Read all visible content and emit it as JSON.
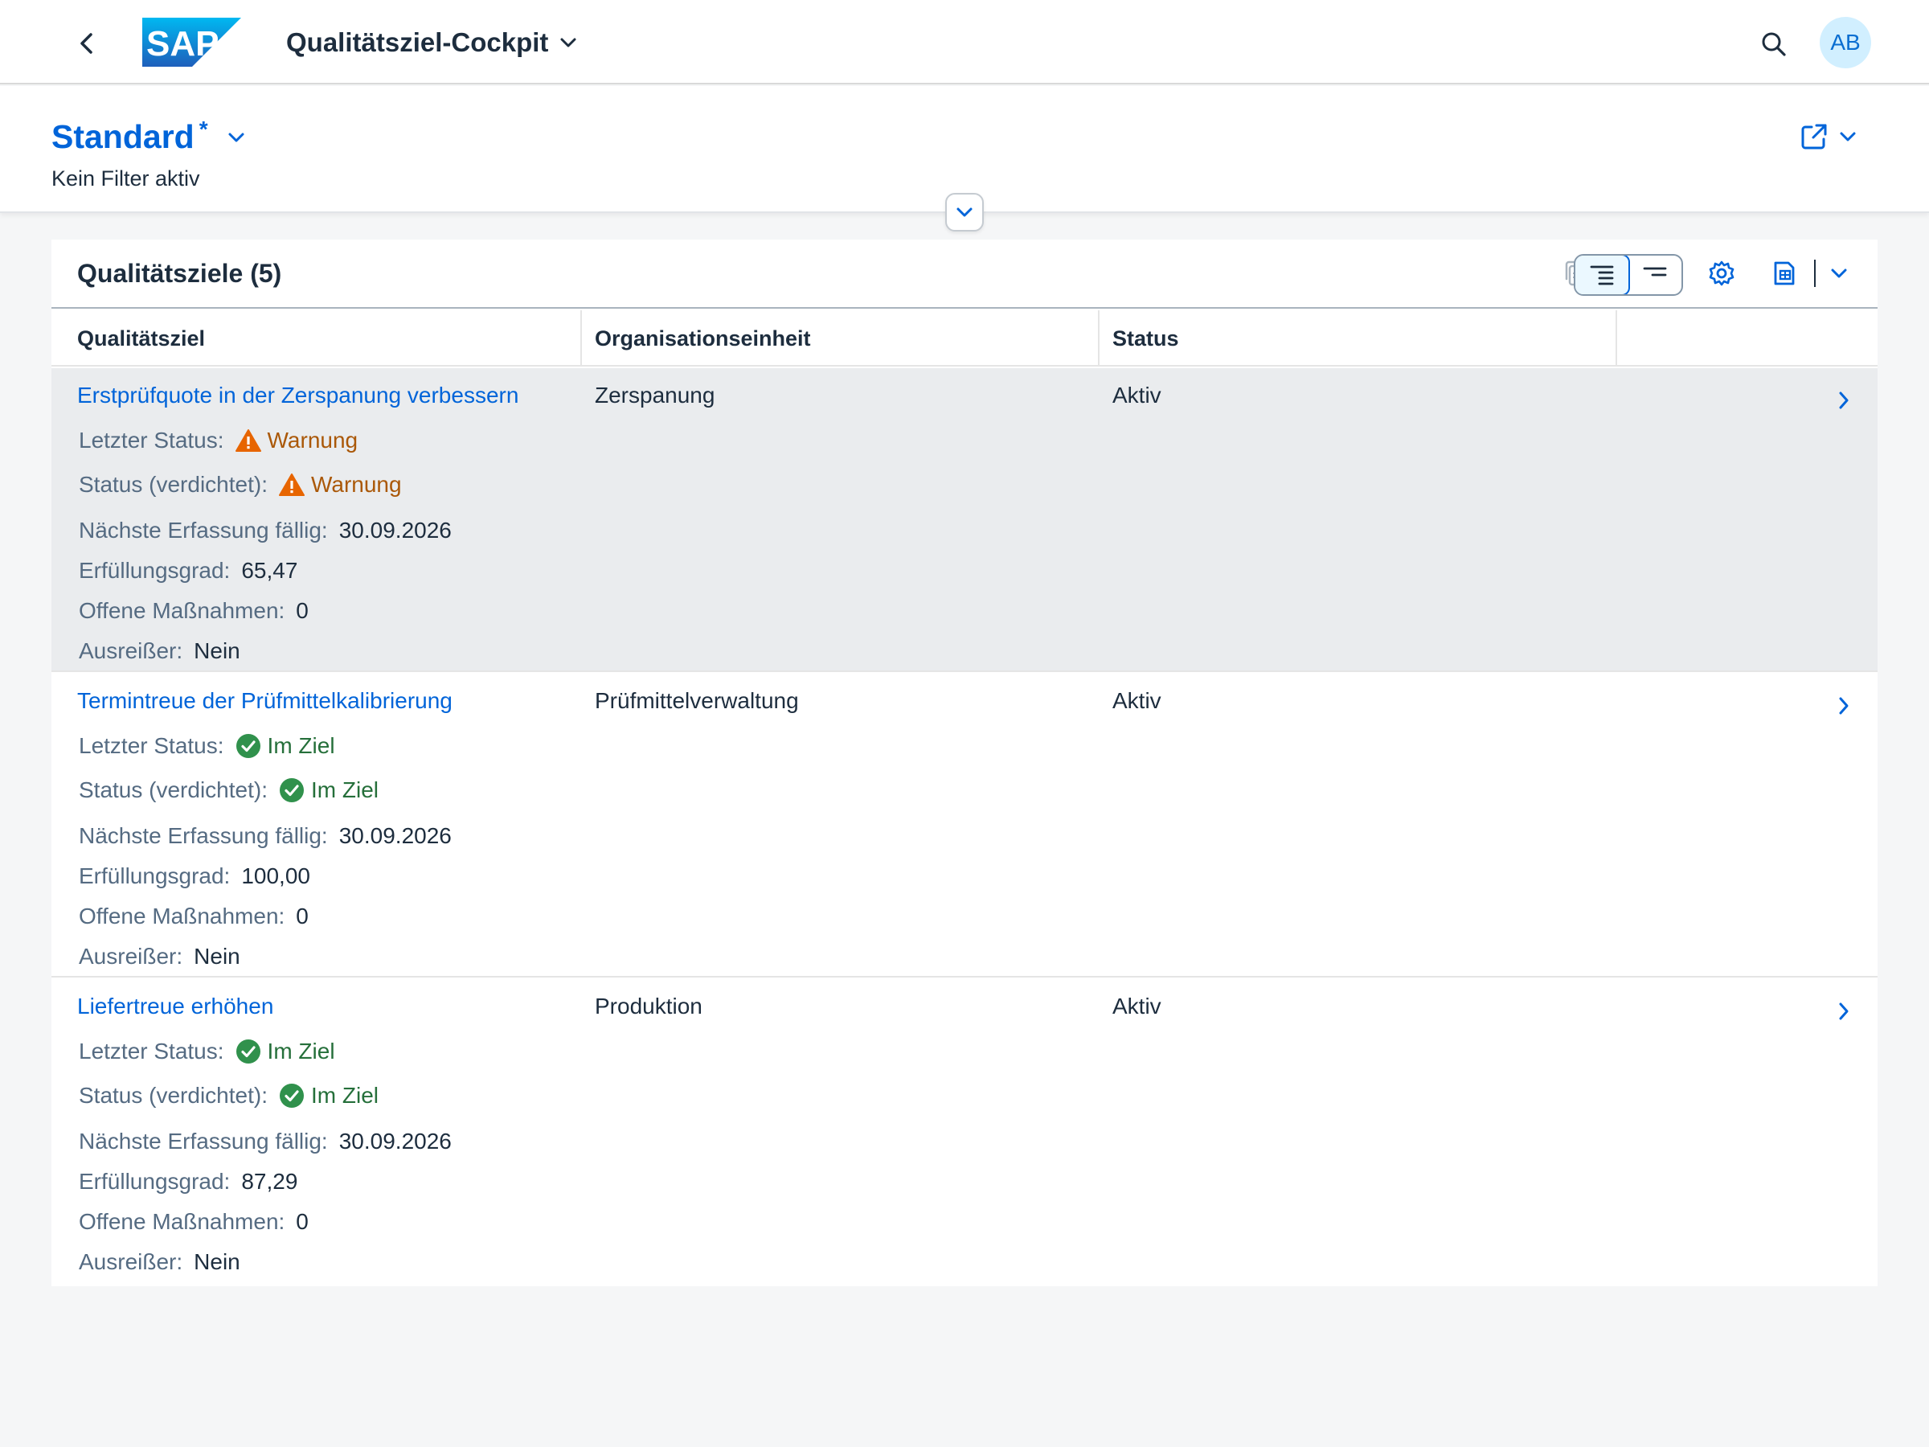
{
  "shell": {
    "app_title": "Qualitätsziel-Cockpit",
    "avatar_initials": "AB",
    "logo_text": "SAP"
  },
  "header": {
    "variant_name": "Standard",
    "variant_modified": "*",
    "filter_status": "Kein Filter aktiv"
  },
  "table": {
    "title": "Qualitätsziele (5)",
    "columns": [
      "Qualitätsziel",
      "Organisationseinheit",
      "Status"
    ],
    "attribute_labels": {
      "last_status": "Letzter Status:",
      "aggregated_status": "Status (verdichtet):",
      "next_due": "Nächste Erfassung fällig:",
      "fulfillment": "Erfüllungsgrad:",
      "open_actions": "Offene Maßnahmen:",
      "outlier": "Ausreißer:"
    },
    "rows": [
      {
        "title": "Erstprüfquote in der Zerspanung verbessern",
        "org_unit": "Zerspanung",
        "status": "Aktiv",
        "last_status": "Warnung",
        "aggregated_status": "Warnung",
        "next_due": "30.09.2026",
        "fulfillment": "65,47",
        "open_actions": "0",
        "outlier": "Nein"
      },
      {
        "title": "Termintreue der Prüfmittelkalibrierung",
        "org_unit": "Prüfmittelverwaltung",
        "status": "Aktiv",
        "last_status": "Im Ziel",
        "aggregated_status": "Im Ziel",
        "next_due": "30.09.2026",
        "fulfillment": "100,00",
        "open_actions": "0",
        "outlier": "Nein"
      },
      {
        "title": "Liefertreue erhöhen",
        "org_unit": "Produktion",
        "status": "Aktiv",
        "last_status": "Im Ziel",
        "aggregated_status": "Im Ziel",
        "next_due": "30.09.2026",
        "fulfillment": "87,29",
        "open_actions": "0",
        "outlier": "Nein"
      }
    ]
  },
  "colors": {
    "brand_blue": "#0064d9",
    "warning": "#e76500",
    "success": "#30914c",
    "link": "#0064d9"
  },
  "icons": [
    "back-icon",
    "chevron-down-icon",
    "search-icon",
    "share-icon",
    "copy-icon",
    "expand-rows-icon",
    "condensed-rows-icon",
    "settings-icon",
    "export-icon",
    "chevron-right-icon",
    "warning-icon",
    "success-icon"
  ]
}
